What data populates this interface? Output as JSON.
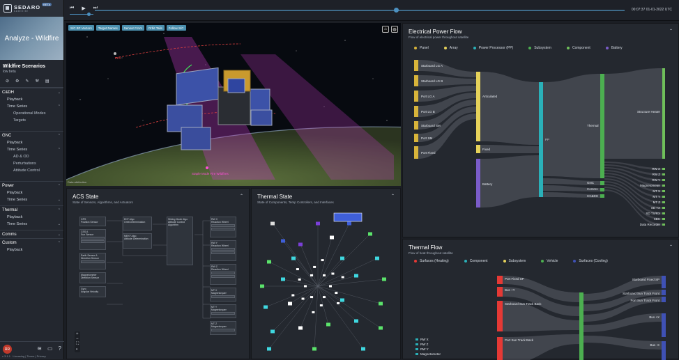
{
  "brand": {
    "name": "SEDARO",
    "sub": "satellite",
    "badge": "BETA"
  },
  "hero": {
    "title": "Analyze - Wildfire"
  },
  "scenario": {
    "title": "Wildfire Scenarios",
    "subtitle": "low beta"
  },
  "nav": {
    "cdh": {
      "label": "C&DH",
      "playback": "Playback",
      "timeseries": "Time Series",
      "modes": "Operational Modes",
      "targets": "Targets"
    },
    "gnc": {
      "label": "GNC",
      "playback": "Playback",
      "timeseries": "Time Series",
      "adod": "AD & OD",
      "perturb": "Perturbations",
      "attctrl": "Attitude Control"
    },
    "power": {
      "label": "Power",
      "playback": "Playback",
      "timeseries": "Time Series"
    },
    "thermal": {
      "label": "Thermal",
      "playback": "Playback",
      "timeseries": "Time Series"
    },
    "comms": {
      "label": "Comms"
    },
    "custom": {
      "label": "Custom",
      "playback": "Playback"
    }
  },
  "footer": {
    "avatar": "RR",
    "version": "v 3.1.1",
    "links": "Licensing | Terms | Privacy"
  },
  "timeline": {
    "time": "00:07:37 01-01-2022 UTC"
  },
  "viz": {
    "buttons": [
      "S/C BF Vectors",
      "Target Names",
      "Sensor FoVs",
      "Orbit Tails",
      "Follow S/C"
    ],
    "label_lex": "LEX",
    "label_target": "Staple Mode Fire Wildfires",
    "attribution": "Data attribution"
  },
  "acs": {
    "title": "ACS State",
    "subtitle": "State of Sensors, Algorithms, and Actuators"
  },
  "thermal_state": {
    "title": "Thermal State",
    "subtitle": "State of Components, Temp Controllers, and Interfaces"
  },
  "epf": {
    "title": "Electrical Power Flow",
    "subtitle": "Flow of electrical power throughout satellite",
    "legend": [
      {
        "label": "Panel",
        "color": "#d8b43a"
      },
      {
        "label": "Array",
        "color": "#e6d25a"
      },
      {
        "label": "Power Processor (PP)",
        "color": "#2ab0b8"
      },
      {
        "label": "Subsystem",
        "color": "#4caf50"
      },
      {
        "label": "Component",
        "color": "#6fbf5a"
      },
      {
        "label": "Battery",
        "color": "#7a5cc9"
      }
    ],
    "panels": [
      "Starboard LG A",
      "Starboard LG B",
      "Port LG A",
      "Port LG B",
      "Starboard SM",
      "Port SM",
      "Port Fixed"
    ],
    "arrays": [
      "Articulated",
      "Fixed"
    ],
    "battery": "Battery",
    "pp": "PP",
    "subsystems": [
      "Thermal",
      "GNC",
      "Comms",
      "CC&DH"
    ],
    "components": [
      "Structure Heater",
      "RW X",
      "RW Z",
      "RW Y",
      "Magnetometer",
      "MT X",
      "MT Y",
      "MT Z",
      "SD TX",
      "SD TX/RX",
      "SBC",
      "Data Recorder"
    ]
  },
  "tflow": {
    "title": "Thermal Flow",
    "subtitle": "Flow of heat throughout satellite",
    "legend": [
      {
        "label": "Surfaces (Heating)",
        "color": "#e53935"
      },
      {
        "label": "Component",
        "color": "#2ab0b8"
      },
      {
        "label": "Subsystem",
        "color": "#e6d25a"
      },
      {
        "label": "Vehicle",
        "color": "#4caf50"
      },
      {
        "label": "Surfaces (Cooling)",
        "color": "#3f51b5"
      }
    ],
    "left": [
      "Port Fixed SP",
      "Bus +Y",
      "Starboard Sun Track Back",
      "Port Sun Track Back"
    ],
    "right": [
      "Starboard Fixed SP",
      "Starboard Sun Track Front",
      "Port Sun Track Front",
      "Bus +X",
      "Bus -X"
    ],
    "bottom_left": [
      "RW X",
      "RW Z",
      "RW Y",
      "Magnetometer"
    ]
  }
}
